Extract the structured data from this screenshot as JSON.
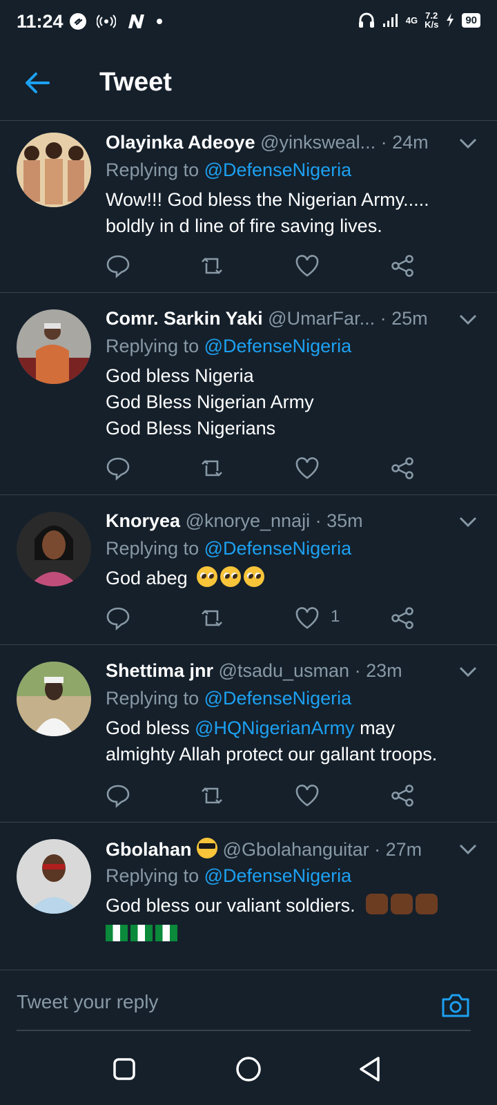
{
  "status_bar": {
    "time": "11:24",
    "network": "4G",
    "speed": "7.2",
    "speed_unit": "K/s",
    "battery": "90"
  },
  "header": {
    "title": "Tweet"
  },
  "tweets": [
    {
      "name": "Olayinka Adeoye",
      "handle": "@yinksweal...",
      "time": "· 24m",
      "replying_prefix": "Replying to",
      "replying_to": "@DefenseNigeria",
      "lines": [
        "Wow!!! God bless the Nigerian Army.....",
        "boldly in d line of fire saving lives."
      ],
      "likes": ""
    },
    {
      "name": "Comr. Sarkin Yaki",
      "handle": "@UmarFar...",
      "time": "· 25m",
      "replying_prefix": "Replying to",
      "replying_to": "@DefenseNigeria",
      "lines": [
        "God bless Nigeria",
        "God Bless Nigerian Army",
        "God Bless Nigerians"
      ],
      "likes": ""
    },
    {
      "name": "Knoryea",
      "handle": "@knorye_nnaji",
      "time": "· 35m",
      "replying_prefix": "Replying to",
      "replying_to": "@DefenseNigeria",
      "lines": [
        "God abeg"
      ],
      "likes": "1"
    },
    {
      "name": "Shettima jnr",
      "handle": "@tsadu_usman",
      "time": "· 23m",
      "replying_prefix": "Replying to",
      "replying_to": "@DefenseNigeria",
      "line1_prefix": "God bless",
      "mention": "@HQNigerianArmy",
      "line1_suffix": "may",
      "line2": "almighty Allah protect our gallant troops.",
      "likes": ""
    },
    {
      "name": "Gbolahan",
      "handle": "@Gbolahanguitar",
      "time": "· 27m",
      "replying_prefix": "Replying to",
      "replying_to": "@DefenseNigeria",
      "lines": [
        "God bless our valiant soldiers."
      ],
      "likes": ""
    }
  ],
  "composer": {
    "placeholder": "Tweet your reply"
  },
  "colors": {
    "background": "#15202b",
    "accent": "#1da1f2",
    "muted": "#8899a6",
    "divider": "#38444d"
  }
}
